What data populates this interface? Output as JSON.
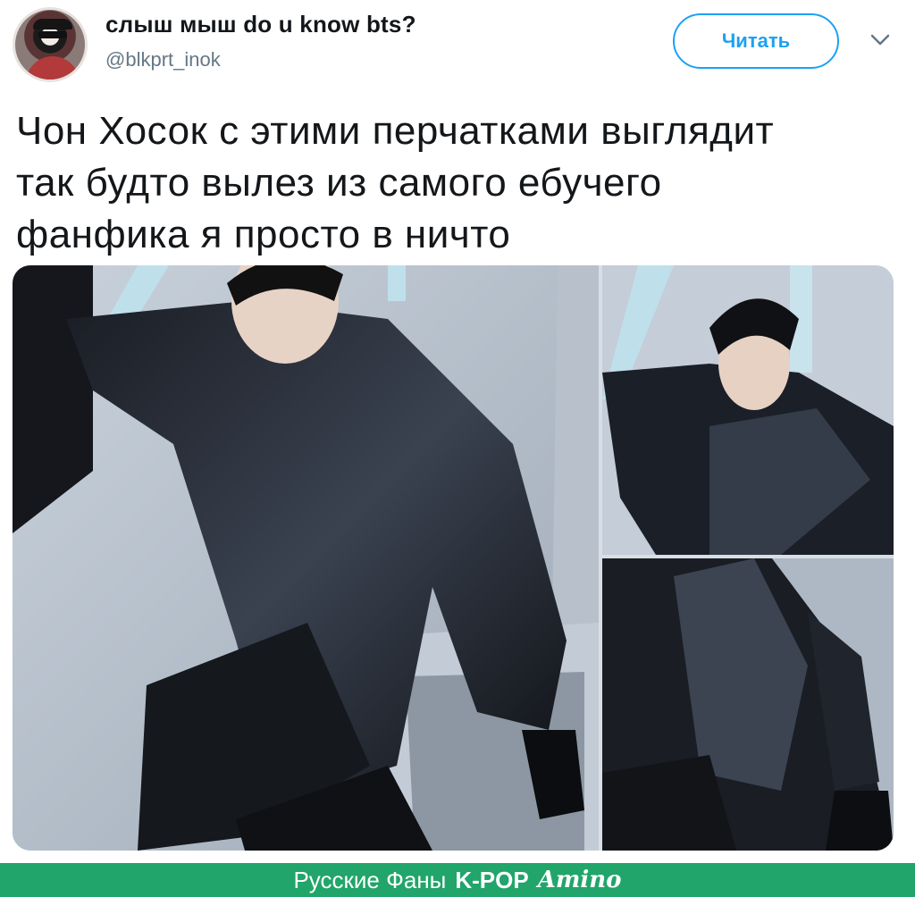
{
  "tweet": {
    "author": {
      "display_name": "слыш мыш do u know bts?",
      "handle": "@blkprt_inok",
      "avatar_icon": "user-avatar"
    },
    "follow_label": "Читать",
    "menu_icon": "chevron-down-icon",
    "text_lines": [
      "Чон Хосок с этими перчатками выглядит",
      "так будто вылез из самого ебучего",
      "фанфика я просто в ничто"
    ],
    "media": {
      "count": 3,
      "photos": [
        "photo-main",
        "photo-top-right",
        "photo-bottom-right"
      ]
    }
  },
  "watermark": {
    "prefix": "Русские Фаны",
    "brand": "K-POP",
    "brand_script": "Amino"
  },
  "colors": {
    "accent": "#1da1f2",
    "text": "#14171a",
    "secondary": "#657786",
    "amino_green": "#21a56a"
  }
}
